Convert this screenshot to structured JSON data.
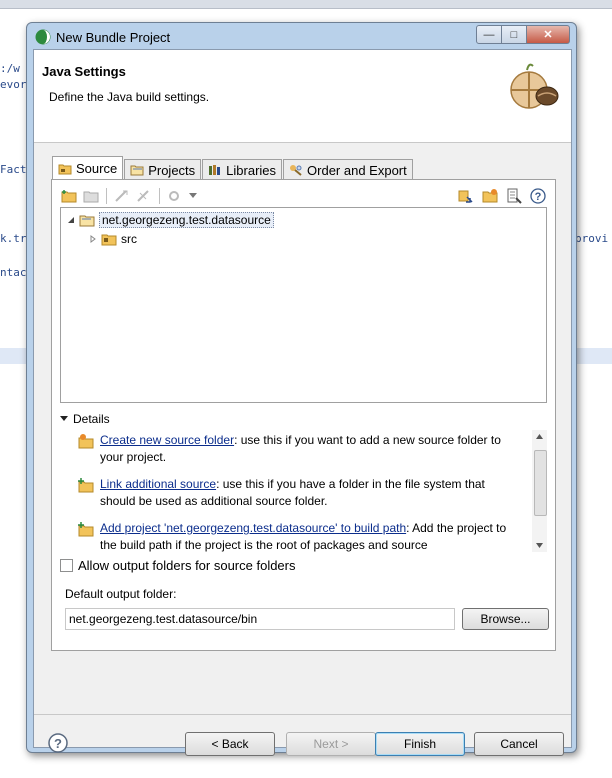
{
  "background": {
    "code_fragments": [
      ":/w",
      "evor",
      "Fact",
      "k.tr",
      "provi",
      "ntac"
    ]
  },
  "dialog": {
    "title": "New Bundle Project",
    "window_buttons": {
      "minimize": "—",
      "maximize": "□",
      "close": "✕"
    },
    "header": {
      "title": "Java Settings",
      "description": "Define the Java build settings."
    },
    "tabs": [
      {
        "label": "Source",
        "icon": "source-folder-icon",
        "active": true
      },
      {
        "label": "Projects",
        "icon": "projects-icon",
        "active": false
      },
      {
        "label": "Libraries",
        "icon": "libraries-icon",
        "active": false
      },
      {
        "label": "Order and Export",
        "icon": "order-export-icon",
        "active": false
      }
    ],
    "tree": {
      "project": "net.georgezeng.test.datasource",
      "child": "src"
    },
    "details": {
      "label": "Details",
      "items": [
        {
          "link": "Create new source folder",
          "rest": ": use this if you want to add a new source folder to your project."
        },
        {
          "link": "Link additional source",
          "rest": ": use this if you have a folder in the file system that should be used as additional source folder."
        },
        {
          "link": "Add project 'net.georgezeng.test.datasource' to build path",
          "rest": ": Add the project to the build path if the project is the root of packages and source"
        }
      ]
    },
    "allow_output_label": "Allow output folders for source folders",
    "default_output_label": "Default output folder:",
    "default_output_value": "net.georgezeng.test.datasource/bin",
    "browse_label": "Browse...",
    "buttons": {
      "help": "?",
      "back": "< Back",
      "next": "Next >",
      "finish": "Finish",
      "cancel": "Cancel"
    }
  },
  "colors": {
    "title_bar": "#b9d1ea",
    "link": "#0b2d8c",
    "panel_bg": "#f0f0f0"
  }
}
